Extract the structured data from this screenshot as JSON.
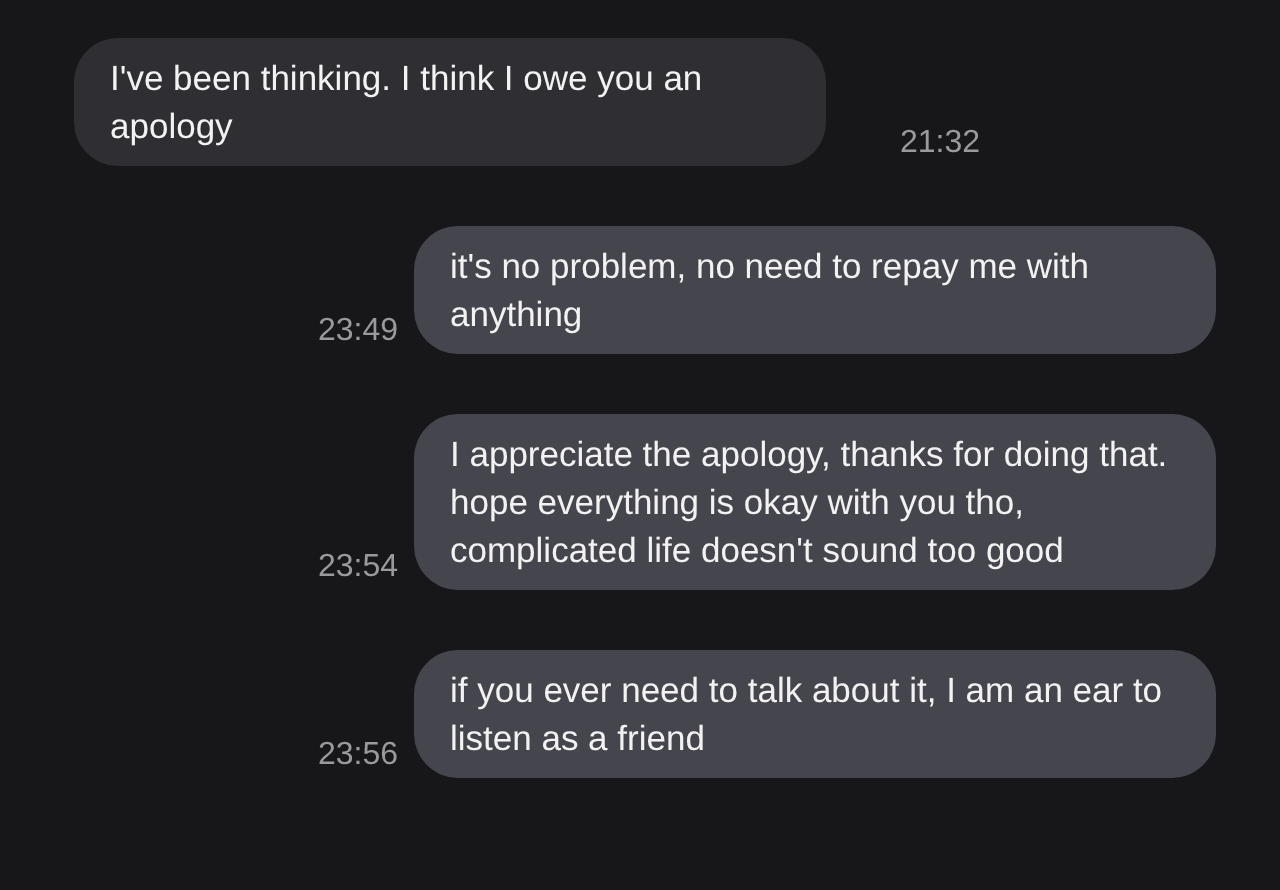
{
  "messages": [
    {
      "kind": "incoming",
      "text": "I've been thinking. I think I owe you an apology",
      "time": "21:32"
    },
    {
      "kind": "outgoing",
      "text": "it's no problem, no need to repay me with anything",
      "time": "23:49"
    },
    {
      "kind": "outgoing",
      "text": "I appreciate the apology, thanks for doing that. hope everything is okay with you tho, complicated life doesn't sound too good",
      "time": "23:54"
    },
    {
      "kind": "outgoing",
      "text": "if you ever need to talk about it, I am an ear to listen as a friend",
      "time": "23:56"
    }
  ]
}
